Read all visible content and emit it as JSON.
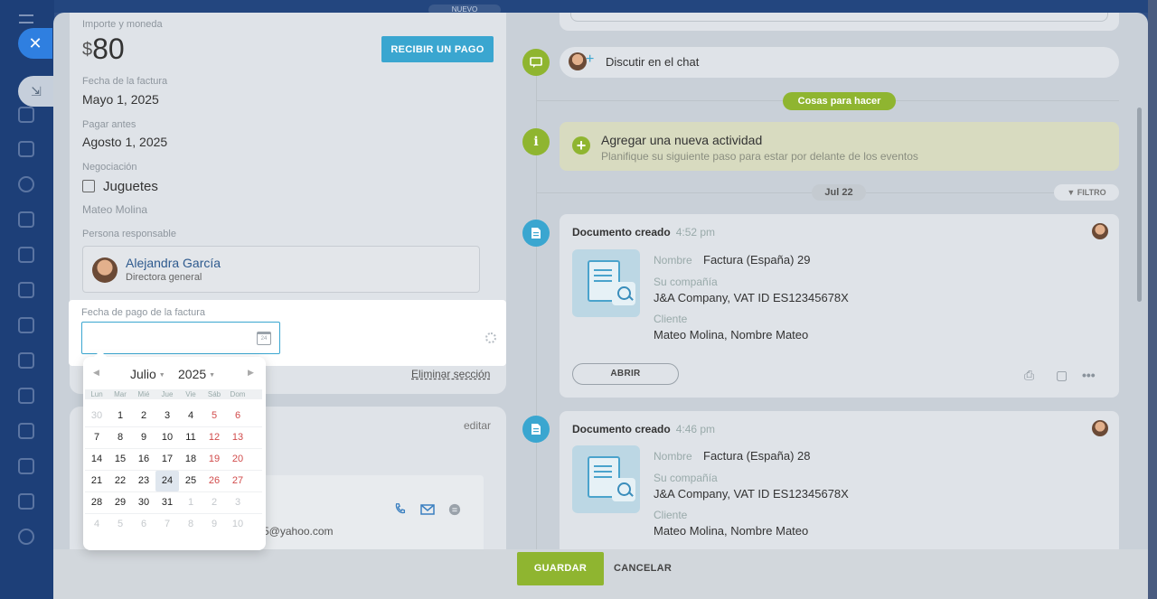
{
  "background": {
    "badge_new": "NUEVO"
  },
  "invoice": {
    "amount_label": "Importe y moneda",
    "currency_symbol": "$",
    "amount_value": "80",
    "receive_payment_button": "RECIBIR UN PAGO",
    "invoice_date_label": "Fecha de la factura",
    "invoice_date_value": "Mayo 1, 2025",
    "pay_before_label": "Pagar antes",
    "pay_before_value": "Agosto 1, 2025",
    "deal_label": "Negociación",
    "deal_value": "Juguetes",
    "client_name": "Mateo Molina",
    "responsible_label": "Persona responsable",
    "responsible_name": "Alejandra García",
    "responsible_role": "Directora general",
    "remove_section": "Eliminar sección",
    "edit_label": "editar",
    "contact_email": "5@yahoo.com"
  },
  "payment_date_field": {
    "label": "Fecha de pago de la factura",
    "value": "",
    "calendar_icon_text": "24"
  },
  "datepicker": {
    "month": "Julio",
    "year": "2025",
    "weekdays": [
      "Lun",
      "Mar",
      "Mié",
      "Jue",
      "Vie",
      "Sáb",
      "Dom"
    ],
    "weeks": [
      [
        "30",
        "1",
        "2",
        "3",
        "4",
        "5",
        "6"
      ],
      [
        "7",
        "8",
        "9",
        "10",
        "11",
        "12",
        "13"
      ],
      [
        "14",
        "15",
        "16",
        "17",
        "18",
        "19",
        "20"
      ],
      [
        "21",
        "22",
        "23",
        "24",
        "25",
        "26",
        "27"
      ],
      [
        "28",
        "29",
        "30",
        "31",
        "1",
        "2",
        "3"
      ],
      [
        "4",
        "5",
        "6",
        "7",
        "8",
        "9",
        "10"
      ]
    ],
    "today": "24",
    "weekend_color": "#d14b4b"
  },
  "timeline": {
    "chat_text": "Discutir en el chat",
    "todo_label": "Cosas para hacer",
    "add_activity_title": "Agregar una nueva actividad",
    "add_activity_sub": "Planifique su siguiente paso para estar por delante de los eventos",
    "date_separator": "Jul 22",
    "filter_label": "FILTRO",
    "documents": [
      {
        "title": "Documento creado",
        "time": "4:52 pm",
        "name_label": "Nombre",
        "name_value": "Factura (España) 29",
        "company_label": "Su compañía",
        "company_value": "J&A Company, VAT ID ES12345678X",
        "client_label": "Cliente",
        "client_value": "Mateo Molina, Nombre Mateo",
        "open_button": "ABRIR"
      },
      {
        "title": "Documento creado",
        "time": "4:46 pm",
        "name_label": "Nombre",
        "name_value": "Factura (España) 28",
        "company_label": "Su compañía",
        "company_value": "J&A Company, VAT ID ES12345678X",
        "client_label": "Cliente",
        "client_value": "Mateo Molina, Nombre Mateo"
      }
    ]
  },
  "footer": {
    "save_button": "GUARDAR",
    "cancel_button": "CANCELAR"
  },
  "colors": {
    "accent_blue": "#3aa6d0",
    "accent_green": "#8fb530"
  }
}
